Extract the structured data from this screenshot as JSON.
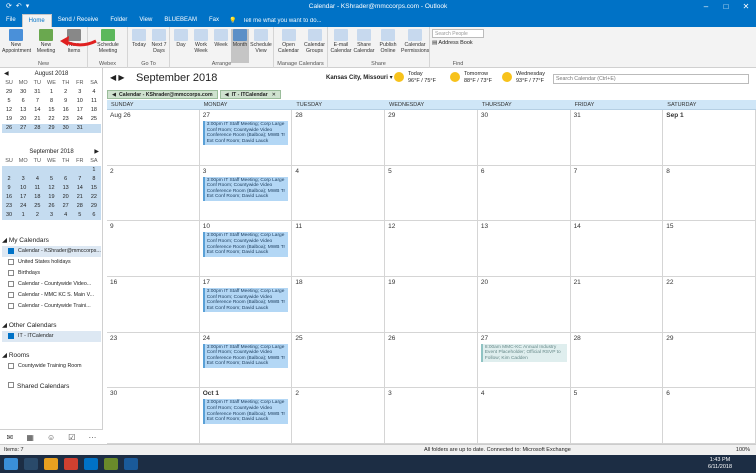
{
  "window": {
    "title": "Calendar - KShrader@mmccorps.com - Outlook",
    "min": "–",
    "max": "□",
    "close": "✕"
  },
  "menu": {
    "tabs": [
      "File",
      "Home",
      "Send / Receive",
      "Folder",
      "View",
      "BLUEBEAM",
      "Fax"
    ],
    "active": "Home",
    "tell_me": "Tell me what you want to do..."
  },
  "ribbon": {
    "groups": [
      {
        "label": "New",
        "buttons": [
          "New Appointment",
          "New Meeting",
          "New Items"
        ]
      },
      {
        "label": "Webex",
        "buttons": [
          "Schedule Meeting"
        ]
      },
      {
        "label": "Go To",
        "buttons": [
          "Today",
          "Next 7 Days"
        ]
      },
      {
        "label": "Arrange",
        "buttons": [
          "Day",
          "Work Week",
          "Week",
          "Month",
          "Schedule View"
        ]
      },
      {
        "label": "Manage Calendars",
        "buttons": [
          "Open Calendar",
          "Calendar Groups"
        ]
      },
      {
        "label": "Share",
        "buttons": [
          "E-mail Calendar",
          "Share Calendar",
          "Publish Online",
          "Calendar Permissions"
        ]
      },
      {
        "label": "Find",
        "buttons": []
      }
    ],
    "search_people": "Search People",
    "address_book": "Address Book"
  },
  "mini_august": {
    "title": "August 2018",
    "days": [
      "SU",
      "MO",
      "TU",
      "WE",
      "TH",
      "FR",
      "SA"
    ],
    "rows": [
      [
        "29",
        "30",
        "31",
        "1",
        "2",
        "3",
        "4"
      ],
      [
        "5",
        "6",
        "7",
        "8",
        "9",
        "10",
        "11"
      ],
      [
        "12",
        "13",
        "14",
        "15",
        "16",
        "17",
        "18"
      ],
      [
        "19",
        "20",
        "21",
        "22",
        "23",
        "24",
        "25"
      ],
      [
        "26",
        "27",
        "28",
        "29",
        "30",
        "31",
        ""
      ]
    ]
  },
  "mini_september": {
    "title": "September 2018",
    "days": [
      "SU",
      "MO",
      "TU",
      "WE",
      "TH",
      "FR",
      "SA"
    ],
    "rows": [
      [
        "",
        "",
        "",
        "",
        "",
        "",
        "1"
      ],
      [
        "2",
        "3",
        "4",
        "5",
        "6",
        "7",
        "8"
      ],
      [
        "9",
        "10",
        "11",
        "12",
        "13",
        "14",
        "15"
      ],
      [
        "16",
        "17",
        "18",
        "19",
        "20",
        "21",
        "22"
      ],
      [
        "23",
        "24",
        "25",
        "26",
        "27",
        "28",
        "29"
      ],
      [
        "30",
        "1",
        "2",
        "3",
        "4",
        "5",
        "6"
      ]
    ]
  },
  "my_calendars": {
    "header": "My Calendars",
    "items": [
      {
        "label": "Calendar - KShrader@mmccorps...",
        "checked": true,
        "selected": true
      },
      {
        "label": "United States holidays",
        "checked": false
      },
      {
        "label": "Birthdays",
        "checked": false
      },
      {
        "label": "Calendar - Countywide Video...",
        "checked": false
      },
      {
        "label": "Calendar - MMC KC S. Main V...",
        "checked": false
      },
      {
        "label": "Calendar - Countywide Traini...",
        "checked": false
      }
    ]
  },
  "other_calendars": {
    "header": "Other Calendars",
    "items": [
      {
        "label": "IT - ITCalendar",
        "checked": true,
        "selected": true
      }
    ]
  },
  "rooms": {
    "header": "Rooms",
    "items": [
      {
        "label": "Countywide Training Room",
        "checked": false
      }
    ]
  },
  "shared": {
    "header": "Shared Calendars"
  },
  "calendar": {
    "month": "September 2018",
    "location": "Kansas City, Missouri",
    "weather": [
      {
        "label": "Today",
        "temp": "96°F / 75°F"
      },
      {
        "label": "Tomorrow",
        "temp": "88°F / 73°F"
      },
      {
        "label": "Wednesday",
        "temp": "93°F / 77°F"
      }
    ],
    "search": "Search Calendar (Ctrl+E)",
    "tabs": [
      "Calendar - KShrader@mmccorps.com",
      "IT - ITCalendar"
    ],
    "day_headers": [
      "SUNDAY",
      "MONDAY",
      "TUESDAY",
      "WEDNESDAY",
      "THURSDAY",
      "FRIDAY",
      "SATURDAY"
    ],
    "weeks": [
      [
        "Aug 26",
        "27",
        "28",
        "29",
        "30",
        "31",
        "Sep 1"
      ],
      [
        "2",
        "3",
        "4",
        "5",
        "6",
        "7",
        "8"
      ],
      [
        "9",
        "10",
        "11",
        "12",
        "13",
        "14",
        "15"
      ],
      [
        "16",
        "17",
        "18",
        "19",
        "20",
        "21",
        "22"
      ],
      [
        "23",
        "24",
        "25",
        "26",
        "27",
        "28",
        "29"
      ],
      [
        "30",
        "Oct 1",
        "2",
        "3",
        "4",
        "5",
        "6"
      ]
    ],
    "staff_meeting": "3:00pm IT Staff Meeting; Corp Large Conf Room; Countywide Video Conference Room (Balboa); MWB Tr Ext Conf Room; David Lauck",
    "industry_event": "8:00am MMC-KC Annual Industry Event Placeholder; Official RSVP to Follow; Kim Cadden"
  },
  "status": {
    "items": "Items: 7",
    "sync": "All folders are up to date.    Connected to: Microsoft Exchange",
    "zoom": "100%"
  },
  "taskbar": {
    "time": "1:43 PM",
    "date": "6/11/2018"
  }
}
